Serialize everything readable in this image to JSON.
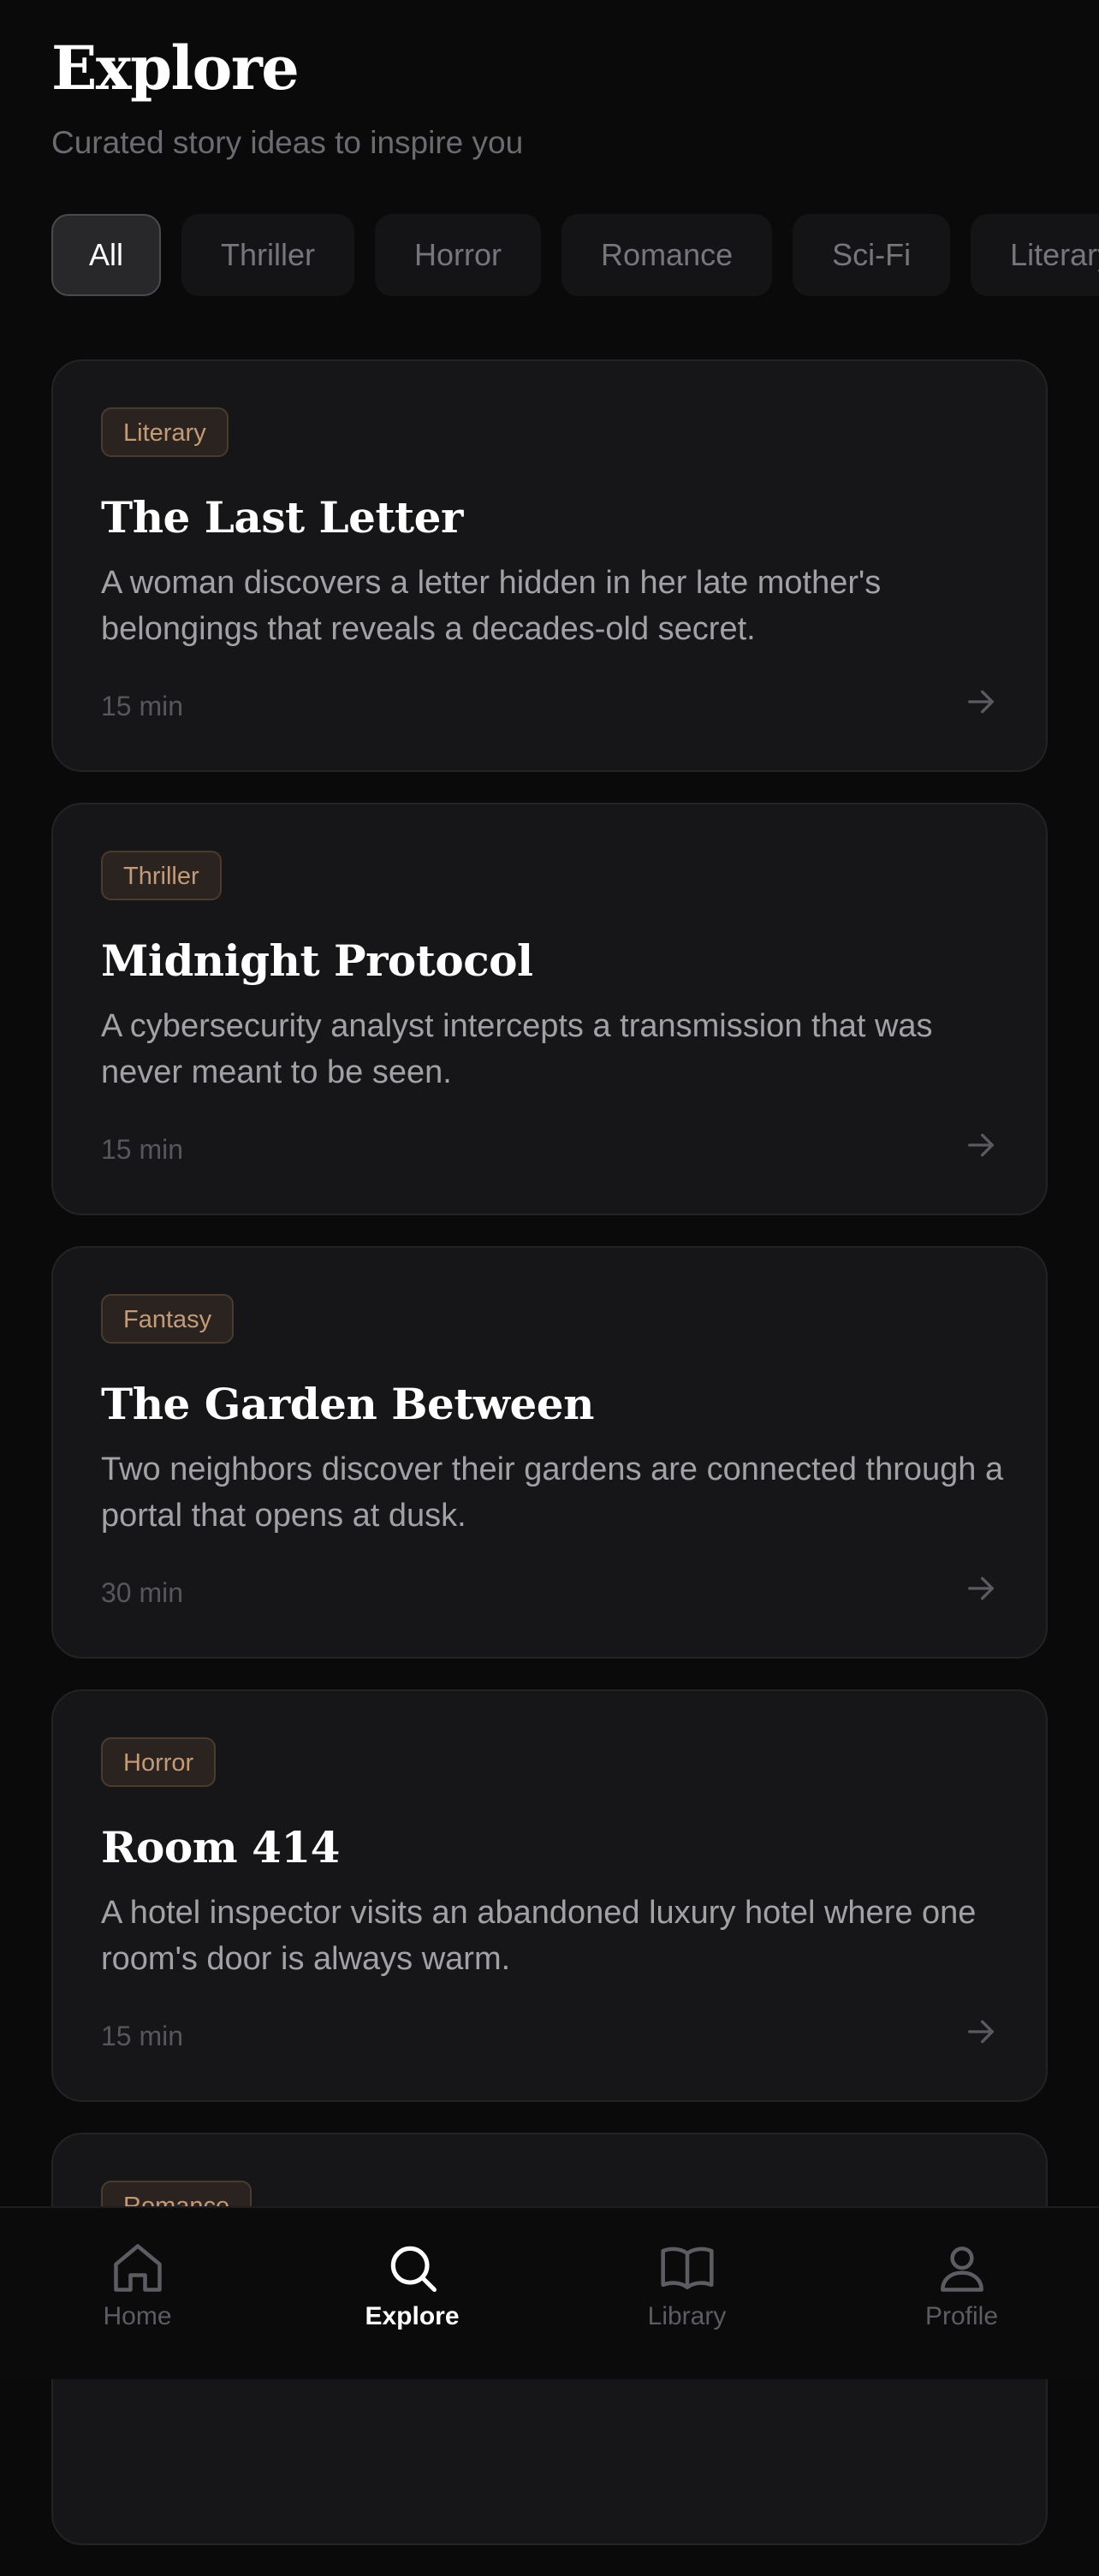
{
  "header": {
    "title": "Explore",
    "subtitle": "Curated story ideas to inspire you"
  },
  "filters": [
    "All",
    "Thriller",
    "Horror",
    "Romance",
    "Sci-Fi",
    "Literary"
  ],
  "active_filter": "All",
  "stories": [
    {
      "tag": "Literary",
      "title": "The Last Letter",
      "description": "A woman discovers a letter hidden in her late mother's belongings that reveals a decades-old secret.",
      "duration": "15 min"
    },
    {
      "tag": "Thriller",
      "title": "Midnight Protocol",
      "description": "A cybersecurity analyst intercepts a transmission that was never meant to be seen.",
      "duration": "15 min"
    },
    {
      "tag": "Fantasy",
      "title": "The Garden Between",
      "description": "Two neighbors discover their gardens are connected through a portal that opens at dusk.",
      "duration": "30 min"
    },
    {
      "tag": "Horror",
      "title": "Room 414",
      "description": "A hotel inspector visits an abandoned luxury hotel where one room's door is always warm.",
      "duration": "15 min"
    },
    {
      "tag": "Romance",
      "title": "",
      "description": "",
      "duration": ""
    }
  ],
  "nav": [
    {
      "label": "Home",
      "icon": "home-icon"
    },
    {
      "label": "Explore",
      "icon": "search-icon"
    },
    {
      "label": "Library",
      "icon": "book-open-icon"
    },
    {
      "label": "Profile",
      "icon": "user-icon"
    }
  ],
  "active_nav": "Explore",
  "colors": {
    "background": "#0a0a0b",
    "card": "#161618",
    "tag_text": "#c49a78",
    "muted": "#6b6b71"
  }
}
